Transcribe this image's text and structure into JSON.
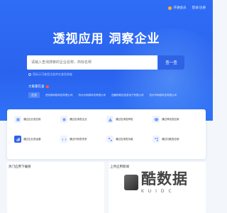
{
  "topbar": {
    "vip_label": "开通会员",
    "login_label": "登录/注册"
  },
  "hero": {
    "headline": "透视应用 洞察企业",
    "search_placeholder": "请输入查询搜索的企业名称、商标名称",
    "search_button": "查一查",
    "hint": "您标示可查验注册并在查验调查",
    "hot_title": "大家都在查",
    "hot_tag": "企业",
    "hot_items": [
      "西安新网络科技有限公司",
      "杭州沃网络科技有限公司",
      "西藏阿斯佳信息电子有限公司",
      "杭州市网络科技有限公司"
    ]
  },
  "grid": {
    "items": [
      {
        "label": "通过企业查应用"
      },
      {
        "label": "通过应用查企业"
      },
      {
        "label": "通过应用查风险"
      },
      {
        "label": "通过风险查应用"
      },
      {
        "label": "通过企业查运营"
      },
      {
        "label": "通过代码查关系"
      },
      {
        "label": "通过应用查功能"
      },
      {
        "label": "通过功能查应用"
      }
    ]
  },
  "bottom": {
    "left_title": "热门应用下载榜",
    "right_title": "上月应用新闻"
  },
  "watermark": {
    "main": "酷数据",
    "sub": "KUIDC"
  },
  "colors": {
    "brand": "#2f63e6",
    "hero_bg": "#2a63ee",
    "accent": "#ffb02e"
  }
}
